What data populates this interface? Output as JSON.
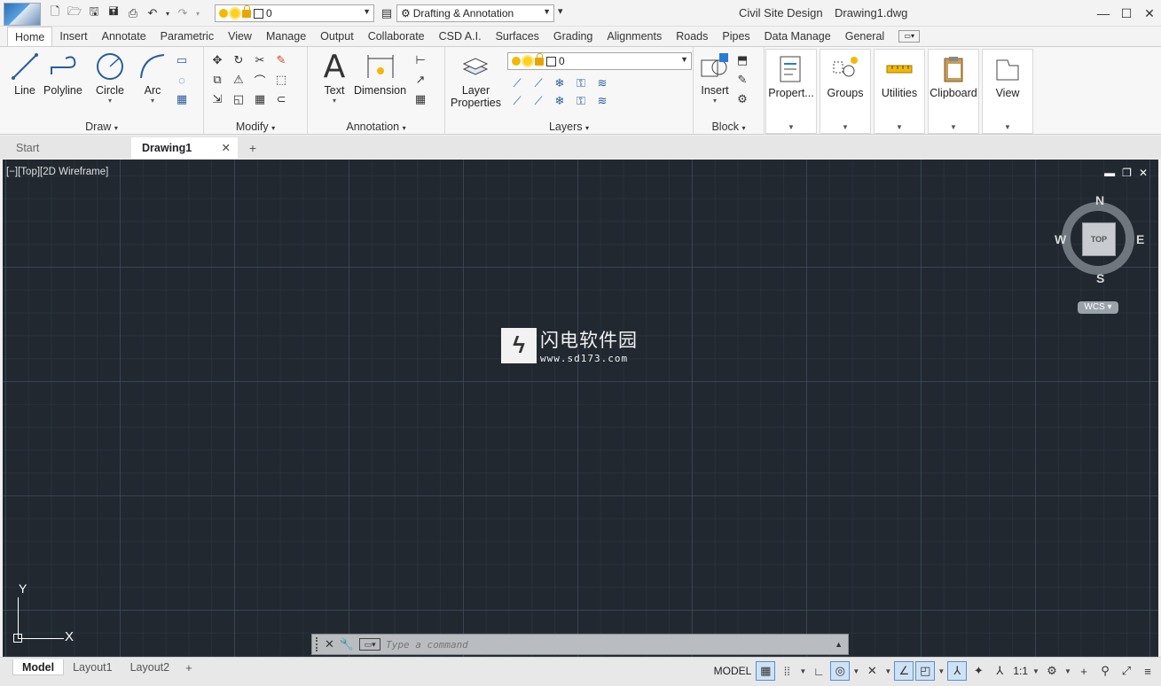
{
  "titlebar": {
    "app_name": "Civil Site Design",
    "doc_name": "Drawing1.dwg",
    "layer_value": "0",
    "workspace": "Drafting & Annotation"
  },
  "ribbon_tabs": [
    "Home",
    "Insert",
    "Annotate",
    "Parametric",
    "View",
    "Manage",
    "Output",
    "Collaborate",
    "CSD A.I.",
    "Surfaces",
    "Grading",
    "Alignments",
    "Roads",
    "Pipes",
    "Data Manage",
    "General"
  ],
  "ribbon": {
    "draw": {
      "title": "Draw",
      "line": "Line",
      "polyline": "Polyline",
      "circle": "Circle",
      "arc": "Arc"
    },
    "modify": {
      "title": "Modify"
    },
    "annotation": {
      "title": "Annotation",
      "text": "Text",
      "dimension": "Dimension"
    },
    "layers": {
      "title": "Layers",
      "layer_properties_1": "Layer",
      "layer_properties_2": "Properties",
      "layer_value": "0"
    },
    "block": {
      "title": "Block",
      "insert": "Insert"
    },
    "tiles": {
      "properties": "Propert...",
      "groups": "Groups",
      "utilities": "Utilities",
      "clipboard": "Clipboard",
      "view": "View"
    }
  },
  "doc_tabs": {
    "start": "Start",
    "drawing": "Drawing1"
  },
  "viewport": {
    "label": "[−][Top][2D Wireframe]",
    "compass": {
      "n": "N",
      "s": "S",
      "e": "E",
      "w": "W",
      "top": "TOP"
    },
    "wcs": "WCS",
    "ucs_x": "X",
    "ucs_y": "Y",
    "watermark_cn": "闪电软件园",
    "watermark_url": "www.sd173.com"
  },
  "command": {
    "placeholder": "Type a command"
  },
  "status": {
    "layouts": [
      "Model",
      "Layout1",
      "Layout2"
    ],
    "model": "MODEL",
    "scale": "1:1"
  }
}
